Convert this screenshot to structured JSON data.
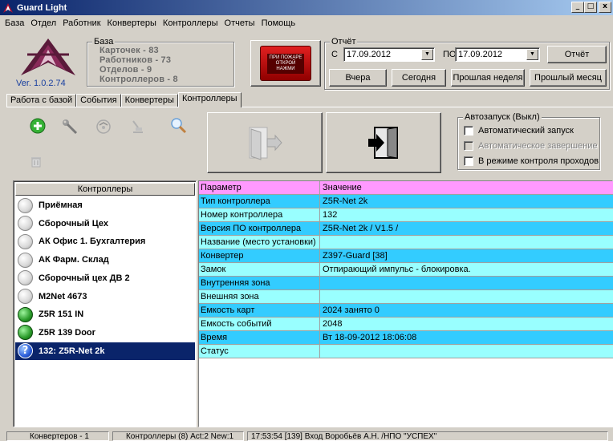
{
  "window": {
    "title": "Guard Light",
    "minimize": "_",
    "maximize": "□",
    "close": "x"
  },
  "menu": [
    "База",
    "Отдел",
    "Работник",
    "Конвертеры",
    "Контроллеры",
    "Отчеты",
    "Помощь"
  ],
  "db": {
    "title": "База",
    "cards": "Карточек - 83",
    "workers": "Работников - 73",
    "departments": "Отделов - 9",
    "controllers": "Контроллеров - 8"
  },
  "version": "Ver. 1.0.2.74",
  "alarm_button": {
    "line1": "ПРИ ПОЖАРЕ",
    "line2": "ОТКРОЙ",
    "line3": "НАЖМИ"
  },
  "report": {
    "title": "Отчёт",
    "from_label": "С",
    "from_date": "17.09.2012",
    "to_label": "ПО",
    "to_date": "17.09.2012",
    "report_btn": "Отчёт",
    "yesterday_btn": "Вчера",
    "today_btn": "Сегодня",
    "last_week_btn": "Прошлая неделя",
    "last_month_btn": "Прошлый месяц"
  },
  "tabs": [
    "Работа с базой",
    "События",
    "Конвертеры",
    "Контроллеры"
  ],
  "autostart": {
    "title": "Автозапуск (Выкл)",
    "auto_start": "Автоматический запуск",
    "auto_finish": "Автоматическое завершение",
    "pass_control": "В режиме контроля проходов"
  },
  "controllers_header": "Контроллеры",
  "controllers": [
    {
      "name": "Приёмная",
      "state": "grey"
    },
    {
      "name": "Сборочный Цех",
      "state": "grey"
    },
    {
      "name": "АК Офис 1. Бухгалтерия",
      "state": "grey"
    },
    {
      "name": "АК Фарм. Склад",
      "state": "grey"
    },
    {
      "name": "Сборочный цех ДВ 2",
      "state": "grey"
    },
    {
      "name": "M2Net 4673",
      "state": "grey"
    },
    {
      "name": "Z5R 151 IN",
      "state": "green"
    },
    {
      "name": "Z5R 139 Door",
      "state": "green"
    },
    {
      "name": "132: Z5R-Net 2k",
      "state": "selected"
    }
  ],
  "grid": {
    "header": {
      "param": "Параметр",
      "value": "Значение"
    },
    "rows": [
      {
        "param": "Тип контроллера",
        "value": "Z5R-Net 2k"
      },
      {
        "param": "Номер контроллера",
        "value": "132"
      },
      {
        "param": "Версия ПО контроллера",
        "value": "Z5R-Net 2k / V1.5 /"
      },
      {
        "param": "Название (место установки)",
        "value": ""
      },
      {
        "param": "Конвертер",
        "value": "Z397-Guard [38]"
      },
      {
        "param": "Замок",
        "value": "Отпирающий импульс - блокировка."
      },
      {
        "param": "Внутренняя зона",
        "value": ""
      },
      {
        "param": "Внешняя зона",
        "value": ""
      },
      {
        "param": "Емкость карт",
        "value": "2024 занято 0"
      },
      {
        "param": "Емкость событий",
        "value": "2048"
      },
      {
        "param": "Время",
        "value": "Вт 18-09-2012 18:06:08"
      },
      {
        "param": "Статус",
        "value": ""
      }
    ]
  },
  "status": {
    "converters": "Конвертеров - 1",
    "controllers": "Контроллеры (8) Act:2 New:1",
    "last_event": "17:53:54 [139] Вход Воробьёв А.Н. /НПО \"УСПЕХ\""
  },
  "colors": {
    "grid_header": "#ff99ff",
    "grid_row_a": "#33ccff",
    "grid_row_b": "#99ffff",
    "selection": "#0a246a"
  }
}
